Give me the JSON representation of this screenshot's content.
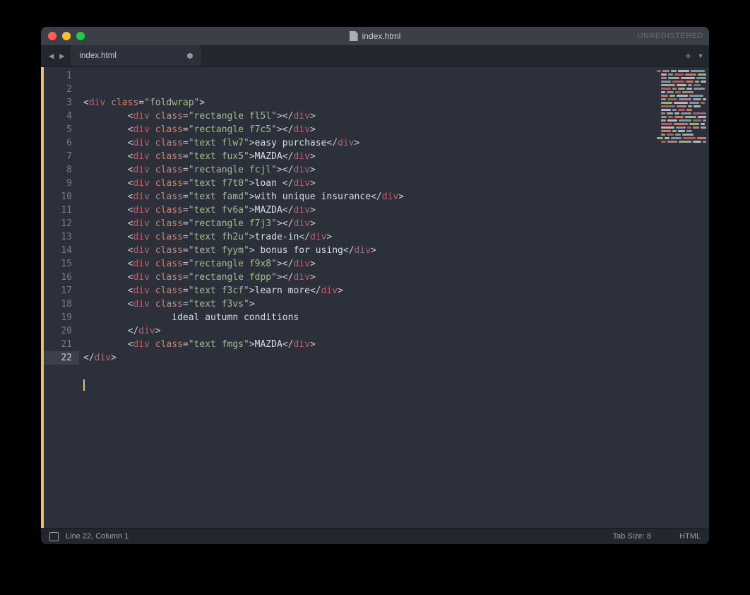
{
  "window": {
    "title": "index.html",
    "registration": "UNREGISTERED"
  },
  "tabs": [
    {
      "label": "index.html",
      "dirty": true
    }
  ],
  "statusbar": {
    "position": "Line 22, Column 1",
    "tab_size": "Tab Size: 8",
    "syntax": "HTML"
  },
  "editor": {
    "active_line": 22,
    "line_count": 22,
    "lines": [
      {
        "n": 1,
        "indent": 0,
        "kind": "open",
        "tag": "div",
        "attr": "class",
        "val": "foldwrap"
      },
      {
        "n": 2,
        "indent": 2,
        "kind": "empty",
        "tag": "div",
        "attr": "class",
        "val": "rectangle fl5l"
      },
      {
        "n": 3,
        "indent": 2,
        "kind": "empty",
        "tag": "div",
        "attr": "class",
        "val": "rectangle f7c5"
      },
      {
        "n": 4,
        "indent": 2,
        "kind": "text",
        "tag": "div",
        "attr": "class",
        "val": "text flw7",
        "text": "easy purchase"
      },
      {
        "n": 5,
        "indent": 2,
        "kind": "text",
        "tag": "div",
        "attr": "class",
        "val": "text fux5",
        "text": "MAZDA"
      },
      {
        "n": 6,
        "indent": 2,
        "kind": "empty",
        "tag": "div",
        "attr": "class",
        "val": "rectangle fcjl"
      },
      {
        "n": 7,
        "indent": 2,
        "kind": "text",
        "tag": "div",
        "attr": "class",
        "val": "text f7t0",
        "text": "loan "
      },
      {
        "n": 8,
        "indent": 2,
        "kind": "text",
        "tag": "div",
        "attr": "class",
        "val": "text famd",
        "text": "with unique insurance"
      },
      {
        "n": 9,
        "indent": 2,
        "kind": "text",
        "tag": "div",
        "attr": "class",
        "val": "text fv6a",
        "text": "MAZDA"
      },
      {
        "n": 10,
        "indent": 2,
        "kind": "empty",
        "tag": "div",
        "attr": "class",
        "val": "rectangle f7j3"
      },
      {
        "n": 11,
        "indent": 2,
        "kind": "text",
        "tag": "div",
        "attr": "class",
        "val": "text fh2u",
        "text": "trade-in"
      },
      {
        "n": 12,
        "indent": 2,
        "kind": "text",
        "tag": "div",
        "attr": "class",
        "val": "text fyym",
        "text": " bonus for using"
      },
      {
        "n": 13,
        "indent": 2,
        "kind": "empty",
        "tag": "div",
        "attr": "class",
        "val": "rectangle f9x8"
      },
      {
        "n": 14,
        "indent": 2,
        "kind": "empty",
        "tag": "div",
        "attr": "class",
        "val": "rectangle fdpp"
      },
      {
        "n": 15,
        "indent": 2,
        "kind": "text",
        "tag": "div",
        "attr": "class",
        "val": "text f3cf",
        "text": "learn more"
      },
      {
        "n": 16,
        "indent": 2,
        "kind": "open",
        "tag": "div",
        "attr": "class",
        "val": "text f3vs"
      },
      {
        "n": 17,
        "indent": 2,
        "kind": "raw",
        "text": "        ideal autumn conditions"
      },
      {
        "n": 18,
        "indent": 2,
        "kind": "close",
        "tag": "div"
      },
      {
        "n": 19,
        "indent": 2,
        "kind": "text",
        "tag": "div",
        "attr": "class",
        "val": "text fmgs",
        "text": "MAZDA"
      },
      {
        "n": 20,
        "indent": 0,
        "kind": "close",
        "tag": "div"
      },
      {
        "n": 21,
        "indent": 0,
        "kind": "blank"
      },
      {
        "n": 22,
        "indent": 0,
        "kind": "blank"
      }
    ]
  },
  "minimap_colors": [
    "#bf616a",
    "#d08770",
    "#a3be8c",
    "#c0c5ce",
    "#8fa1b3"
  ]
}
